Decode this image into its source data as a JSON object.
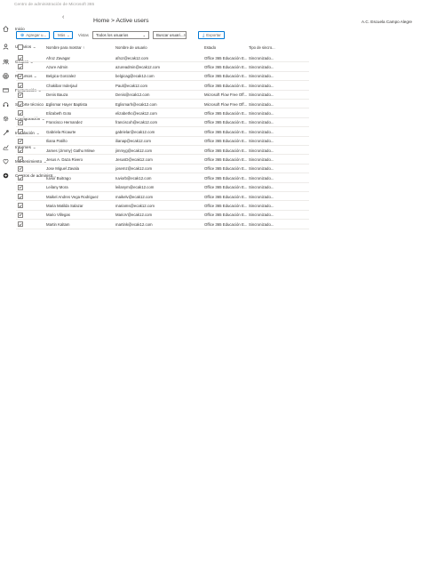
{
  "app": {
    "title": "Centro de administración de Microsoft 365",
    "org": "A.C. Escuela Campo Alegre"
  },
  "breadcrumb": "Home > Active users",
  "nav": {
    "collapse_icon": "chevron-left-icon",
    "items": [
      {
        "label": "Inicio",
        "icon": "home-icon",
        "has_chevron": false
      },
      {
        "label": "Usuarios",
        "icon": "user-icon",
        "has_chevron": true
      },
      {
        "label": "Grupos",
        "icon": "group-icon",
        "has_chevron": true
      },
      {
        "label": "Recursos",
        "icon": "printer-icon",
        "has_chevron": true
      },
      {
        "label": "Facturación",
        "icon": "billing-icon",
        "has_chevron": true
      },
      {
        "label": "Soporte técnico",
        "icon": "headset-icon",
        "has_chevron": true
      },
      {
        "label": "Configuración",
        "icon": "gear-icon",
        "has_chevron": true
      },
      {
        "label": "Instalación",
        "icon": "wrench-icon",
        "has_chevron": true
      },
      {
        "label": "Informes",
        "icon": "chart-icon",
        "has_chevron": true
      },
      {
        "label": "Mantenimiento",
        "icon": "heart-icon",
        "has_chevron": true
      },
      {
        "label": "Centros de administr...",
        "icon": "admin-center-icon",
        "has_chevron": false
      }
    ]
  },
  "toolbar": {
    "add_label": "Agregar u...",
    "more_label": "Más",
    "views_label": "Vistas",
    "views_value": "Todos los usuarios",
    "search_placeholder": "Buscar usuari...",
    "export_label": "Exportar"
  },
  "table": {
    "headers": {
      "name": "Nombre para mostrar ↑",
      "username": "Nombre de usuario",
      "licenses": "Estado",
      "sync": "Tipo de sincro..."
    },
    "rows": [
      {
        "name": "Afroz Zavagar",
        "user": "afroz@ecak12.com",
        "lic": "Office 365 Educación E...",
        "sync": "Sincronizado..."
      },
      {
        "name": "Azure Admin",
        "user": "azureadmin@ecak12.com",
        "lic": "Office 365 Educación E...",
        "sync": "Sincronizado..."
      },
      {
        "name": "Belgica Gonzalez",
        "user": "belgicag@ecak12.com",
        "lic": "Office 365 Educación E...",
        "sync": "Sincronizado..."
      },
      {
        "name": "Chakibar Inderjaul",
        "user": "Paul@ecak12.com",
        "lic": "Office 365 Educación E...",
        "sync": "Sincronizado..."
      },
      {
        "name": "Denis Bauza",
        "user": "Denis@ecak12.com",
        "lic": "Microsoft Flow Free Off...",
        "sync": "Sincronizado..."
      },
      {
        "name": "Eglismar Hayer Baptista",
        "user": "Eglismarh@ecak12.com",
        "lic": "Microsoft Flow Free Off...",
        "sync": "Sincronizado..."
      },
      {
        "name": "Elizabeth Goto",
        "user": "elizabethc@ecak12.com",
        "lic": "Office 365 Educación E...",
        "sync": "Sincronizado..."
      },
      {
        "name": "Francisco Hernandez",
        "user": "franciscoh@ecak12.com",
        "lic": "Office 365 Educación E...",
        "sync": "Sincronizado..."
      },
      {
        "name": "Gabriela Ricaurte",
        "user": "gabrielar@ecak12.com",
        "lic": "Office 365 Educación E...",
        "sync": "Sincronizado..."
      },
      {
        "name": "Iliana Patiño",
        "user": "ilianap@ecak12.com",
        "lic": "Office 365 Educación E...",
        "sync": "Sincronizado..."
      },
      {
        "name": "James (Jimmy) Gathu Mirwe",
        "user": "jimmyg@ecak12.com",
        "lic": "Office 365 Educación E...",
        "sync": "Sincronizado..."
      },
      {
        "name": "Jesus A. Daza Rivero",
        "user": "JesusD@ecak12.com",
        "lic": "Office 365 Educación E...",
        "sync": "Sincronizado..."
      },
      {
        "name": "Jose Miguel Zavala",
        "user": "josemz@ecak12.com",
        "lic": "Office 365 Educación E...",
        "sync": "Sincronizado..."
      },
      {
        "name": "Iuvior Buitrago",
        "user": "Iuviorb@ecak12.com",
        "lic": "Office 365 Educación E...",
        "sync": "Sincronizado..."
      },
      {
        "name": "Leilany Mora",
        "user": "leilanym@ecak12.com",
        "lic": "Office 365 Educación E...",
        "sync": "Sincronizado..."
      },
      {
        "name": "Maikel Andres Vega Rodriguez",
        "user": "maikelv@ecak12.com",
        "lic": "Office 365 Educación E...",
        "sync": "Sincronizado..."
      },
      {
        "name": "Maria Matilda Salazar",
        "user": "mariams@ecak12.com",
        "lic": "Office 365 Educación E...",
        "sync": "Sincronizado..."
      },
      {
        "name": "Mario Villegas",
        "user": "MarioV@ecak12.com",
        "lic": "Office 365 Educación E...",
        "sync": "Sincronizado..."
      },
      {
        "name": "Martin Kaltam",
        "user": "martink@ecak12.com",
        "lic": "Office 365 Educación E...",
        "sync": "Sincronizado..."
      }
    ]
  },
  "colors": {
    "accent": "#0078d4",
    "text": "#323130",
    "muted": "#605e5c",
    "border": "#edebe9"
  }
}
